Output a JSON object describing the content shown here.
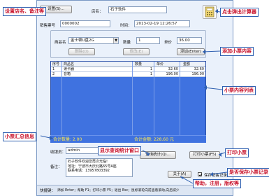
{
  "form": {
    "host_button": "设置(S)...",
    "store_label": "店名：",
    "store_name": "石子软件",
    "receipt_no_label": "销售票号",
    "receipt_no": "0000002",
    "time_label": "时间：",
    "time_value": "2013-02-19 12:26:57",
    "product_label": "商品名",
    "product_value": "金士顿U盘2G",
    "qty_label": "数量",
    "qty_value": "1",
    "price_label": "单价",
    "price_value": "36.00",
    "add_button": "添加(Enter)",
    "btn_delete": "删除(D)",
    "btn_modify": "修改(E)"
  },
  "grid": {
    "columns": [
      "序号",
      "商品名",
      "数量",
      "单价",
      "金额"
    ],
    "rows": [
      [
        "1",
        "读卡器",
        "1",
        "32.60",
        "32.60"
      ],
      [
        "2",
        "音箱",
        "1",
        "196.00",
        "196.00"
      ]
    ],
    "sum_qty": "合计数量: 2.00",
    "sum_amount": "合计金额: 228.60 元"
  },
  "footer_form": {
    "cashier_label": "收银员：",
    "cashier_value": "admin",
    "note_label": "备注：",
    "note_lines": [
      "石子软件欢迎您再次光临!",
      "地址：宁波市大庆北路65号A座",
      "联系电话：13957803392"
    ],
    "query_button": "查询统计(Q)...",
    "print_button": "打印小票(F5)",
    "about_button": "关于(A)",
    "save_checkbox_label": "保存销售记录",
    "shortcut_label": "快捷键：",
    "shortcut_text": "添加 Enter；帮助 F1；打印小票 F5；退出 Esc；鼠标滚轮向前查看滚动,向后减少"
  },
  "annotations": {
    "settings": "设置店名、备注等",
    "calculator": "点击弹出计算器",
    "add_items": "添加小票内容",
    "list": "小票内容列表",
    "summary": "小票汇总信息",
    "stats": "显示查询统计窗口",
    "print": "打印小票",
    "help": "帮助，注册，版权等",
    "save": "是否保存小票记录"
  },
  "colors": {
    "annotation_text": "#c8132c",
    "annotation_border": "#2e5fb0",
    "grid_background": "#3f72e0",
    "summary_text": "#ffe84a"
  }
}
